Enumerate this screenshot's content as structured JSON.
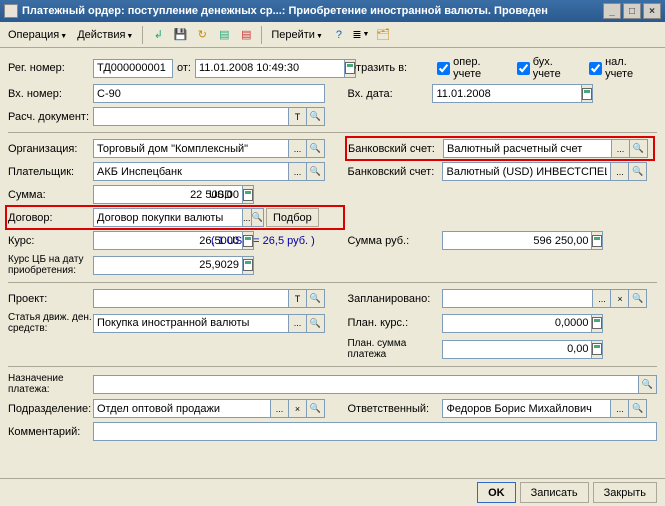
{
  "window": {
    "title": "Платежный ордер: поступление денежных ср...: Приобретение иностранной валюты. Проведен"
  },
  "toolbar": {
    "operation": "Операция",
    "actions": "Действия",
    "goto": "Перейти"
  },
  "fields": {
    "reg_num_label": "Рег. номер:",
    "reg_num": "ТД000000001",
    "from_label": "от:",
    "from_date": "11.01.2008 10:49:30",
    "reflect_label": "Отразить в:",
    "chk_oper": "опер. учете",
    "chk_buh": "бух. учете",
    "chk_nal": "нал. учете",
    "in_num_label": "Вх. номер:",
    "in_num": "С-90",
    "in_date_label": "Вх. дата:",
    "in_date": "11.01.2008",
    "calc_doc_label": "Расч. документ:",
    "calc_doc": "",
    "org_label": "Организация:",
    "org": "Торговый дом \"Комплексный\"",
    "bank1_label": "Банковский счет:",
    "bank1": "Валютный расчетный счет",
    "payer_label": "Плательщик:",
    "payer": "АКБ Инспецбанк",
    "bank2_label": "Банковский счет:",
    "bank2": "Валютный (USD) ИНВЕСТСПЕЦБАНК",
    "sum_label": "Сумма:",
    "sum": "22 500,00",
    "currency": "USD",
    "contract_label": "Договор:",
    "contract": "Договор покупки валюты",
    "select_btn": "Подбор",
    "rate_label": "Курс:",
    "rate": "26,5000",
    "rate_note": "( 1 USD = 26,5 руб. )",
    "sum_rub_label": "Сумма руб.:",
    "sum_rub": "596 250,00",
    "cb_rate_label": "Курс ЦБ на дату приобретения:",
    "cb_rate": "25,9029",
    "project_label": "Проект:",
    "project": "",
    "planned_label": "Запланировано:",
    "planned": "",
    "dds_label": "Статья движ. ден. средств:",
    "dds": "Покупка иностранной валюты",
    "plan_rate_label": "План. курс.:",
    "plan_rate": "0,0000",
    "plan_sum_label": "План. сумма платежа",
    "plan_sum": "0,00",
    "purpose_label": "Назначение платежа:",
    "purpose": "",
    "dept_label": "Подразделение:",
    "dept": "Отдел оптовой продажи",
    "resp_label": "Ответственный:",
    "resp": "Федоров Борис Михайлович",
    "comment_label": "Комментарий:",
    "comment": ""
  },
  "footer": {
    "ok": "OK",
    "save": "Записать",
    "close": "Закрыть"
  }
}
